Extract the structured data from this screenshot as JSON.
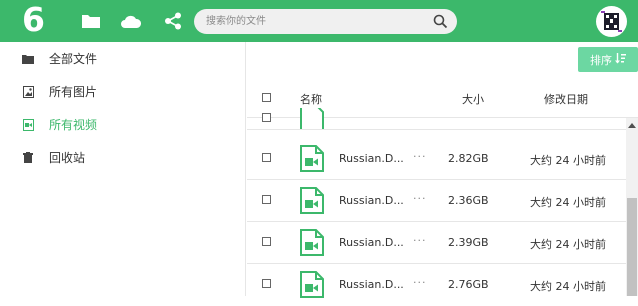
{
  "app": {
    "logo_text": "6",
    "brand_color": "#3cb86b"
  },
  "topbar": {
    "icons": [
      "folder-icon",
      "cloud-icon",
      "share-icon"
    ],
    "search_placeholder": "搜索你的文件"
  },
  "sidebar": {
    "items": [
      {
        "label": "全部文件",
        "icon": "folder-icon"
      },
      {
        "label": "所有图片",
        "icon": "image-icon"
      },
      {
        "label": "所有视频",
        "icon": "video-icon",
        "active": true
      },
      {
        "label": "回收站",
        "icon": "trash-icon"
      }
    ]
  },
  "toolbar": {
    "sort_label": "排序"
  },
  "table": {
    "columns": {
      "name": "名称",
      "size": "大小",
      "date": "修改日期"
    },
    "rows": [
      {
        "name": "Russian.D...",
        "size": "2.82GB",
        "date": "大约 24 小时前"
      },
      {
        "name": "Russian.D...",
        "size": "2.36GB",
        "date": "大约 24 小时前"
      },
      {
        "name": "Russian.D...",
        "size": "2.39GB",
        "date": "大约 24 小时前"
      },
      {
        "name": "Russian.D...",
        "size": "2.76GB",
        "date": "大约 24 小时前"
      }
    ],
    "more_label": "···"
  }
}
